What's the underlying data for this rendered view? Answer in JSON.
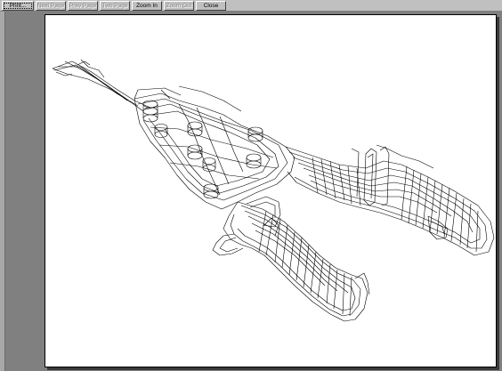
{
  "toolbar": {
    "print_label": "Print...",
    "next_page_label": "Next Page",
    "prev_page_label": "Prev Page",
    "two_page_label": "Two Page",
    "zoom_in_label": "Zoom In",
    "zoom_out_label": "Zoom Out",
    "close_label": "Close"
  },
  "preview": {
    "drawing_subject": "wireframe-pliers"
  }
}
